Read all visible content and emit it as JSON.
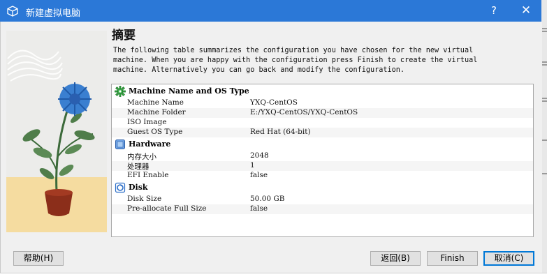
{
  "window": {
    "title": "新建虚拟电脑",
    "help_glyph": "?",
    "close_glyph": "✕",
    "icon": "virtualbox-cube-icon"
  },
  "page": {
    "heading": "摘要",
    "description": "The following table summarizes the configuration you have chosen for the new virtual\nmachine. When you are happy with the configuration press Finish to create the virtual\nmachine. Alternatively you can go back and modify the configuration."
  },
  "sections": [
    {
      "title": "Machine Name and OS Type",
      "icon": "green-gear-icon",
      "rows": [
        {
          "key": "Machine Name",
          "value": "YXQ-CentOS"
        },
        {
          "key": "Machine Folder",
          "value": "E:/YXQ-CentOS/YXQ-CentOS"
        },
        {
          "key": "ISO Image",
          "value": ""
        },
        {
          "key": "Guest OS Type",
          "value": "Red Hat (64-bit)"
        }
      ]
    },
    {
      "title": "Hardware",
      "icon": "chip-icon",
      "rows": [
        {
          "key": "内存大小",
          "value": "2048"
        },
        {
          "key": "处理器",
          "value": "1"
        },
        {
          "key": "EFI Enable",
          "value": "false"
        }
      ]
    },
    {
      "title": "Disk",
      "icon": "disk-icon",
      "rows": [
        {
          "key": "Disk Size",
          "value": "50.00 GB"
        },
        {
          "key": "Pre-allocate Full Size",
          "value": "false"
        }
      ]
    }
  ],
  "buttons": {
    "help": "帮助(H)",
    "back": "返回(B)",
    "finish": "Finish",
    "cancel": "取消(C)"
  },
  "colors": {
    "titlebar": "#2b78d7",
    "dialog_bg": "#f0f0f0",
    "default_button_border": "#0078d7",
    "flower": "#3a7fd0",
    "pot": "#8b2e1a"
  }
}
